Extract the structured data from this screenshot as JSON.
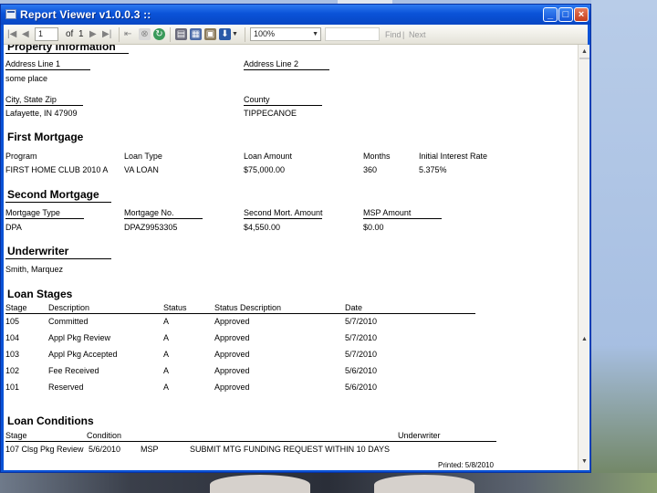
{
  "window": {
    "title": "Report Viewer v1.0.0.3 ::",
    "minimize_label": "_",
    "maximize_label": "□",
    "close_label": "×"
  },
  "toolbar": {
    "page_current": "1",
    "page_of_label": "of",
    "page_total": "1",
    "zoom": "100%",
    "find_label": "Find",
    "find_sep": "|",
    "next_label": "Next"
  },
  "report": {
    "property": {
      "title": "Property Information",
      "address1_label": "Address Line 1",
      "address1_value": "some place",
      "address2_label": "Address Line 2",
      "city_label": "City, State Zip",
      "city_value": "Lafayette, IN 47909",
      "county_label": "County",
      "county_value": "TIPPECANOE"
    },
    "first_mortgage": {
      "title": "First Mortgage",
      "headers": [
        "Program",
        "Loan Type",
        "Loan Amount",
        "Months",
        "Initial Interest Rate"
      ],
      "values": [
        "FIRST HOME CLUB 2010 A",
        "VA LOAN",
        "$75,000.00",
        "360",
        "5.375%"
      ]
    },
    "second_mortgage": {
      "title": "Second Mortgage",
      "headers": [
        "Mortgage Type",
        "Mortgage No.",
        "Second Mort. Amount",
        "MSP Amount"
      ],
      "values": [
        "DPA",
        "DPAZ9953305",
        "$4,550.00",
        "$0.00"
      ]
    },
    "underwriter": {
      "title": "Underwriter",
      "value": "Smith, Marquez"
    },
    "loan_stages": {
      "title": "Loan Stages",
      "headers": [
        "Stage",
        "Description",
        "Status",
        "Status Description",
        "Date"
      ],
      "rows": [
        [
          "105",
          "Committed",
          "A",
          "Approved",
          "5/7/2010"
        ],
        [
          "104",
          "Appl Pkg Review",
          "A",
          "Approved",
          "5/7/2010"
        ],
        [
          "103",
          "Appl Pkg Accepted",
          "A",
          "Approved",
          "5/7/2010"
        ],
        [
          "102",
          "Fee Received",
          "A",
          "Approved",
          "5/6/2010"
        ],
        [
          "101",
          "Reserved",
          "A",
          "Approved",
          "5/6/2010"
        ]
      ]
    },
    "loan_conditions": {
      "title": "Loan Conditions",
      "headers": [
        "Stage",
        "Condition",
        "Underwriter"
      ],
      "row": [
        "107 Clsg Pkg Review",
        "5/6/2010",
        "MSP",
        "SUBMIT MTG FUNDING REQUEST WITHIN 10 DAYS"
      ]
    },
    "printed": "Printed: 5/8/2010"
  },
  "colors": {
    "titlebar": "#0a53d8",
    "toolbar": "#ece9d8",
    "report_bg": "#ffffff",
    "desktop": "#a7bfe2"
  }
}
